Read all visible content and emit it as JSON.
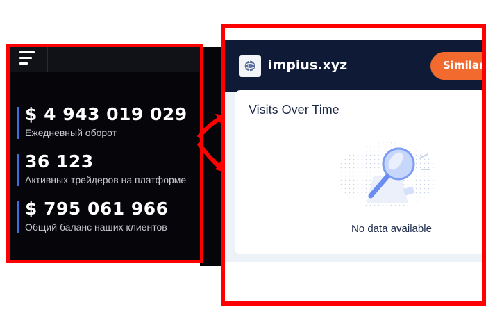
{
  "left_panel": {
    "menu_icon": "hamburger-menu-icon",
    "stats": [
      {
        "value": "$ 4 943 019 029",
        "label": "Ежедневный оборот"
      },
      {
        "value": "36 123",
        "label": "Активных трейдеров на платформе"
      },
      {
        "value": "$ 795 061 966",
        "label": "Общий баланс наших клиентов"
      }
    ],
    "accent_color": "#3d6fe0"
  },
  "widget": {
    "site_name": "impius.xyz",
    "site_icon": "globe-icon",
    "similar_button": "Similarw",
    "card_title": "Visits Over Time",
    "empty_icon": "magnifier-no-data-icon",
    "empty_text": "No data available",
    "colors": {
      "header": "#0f1b36",
      "button": "#f26a2e"
    }
  },
  "annotation": {
    "color": "#ff0000",
    "arrow_icon": "double-arrow-icon"
  }
}
